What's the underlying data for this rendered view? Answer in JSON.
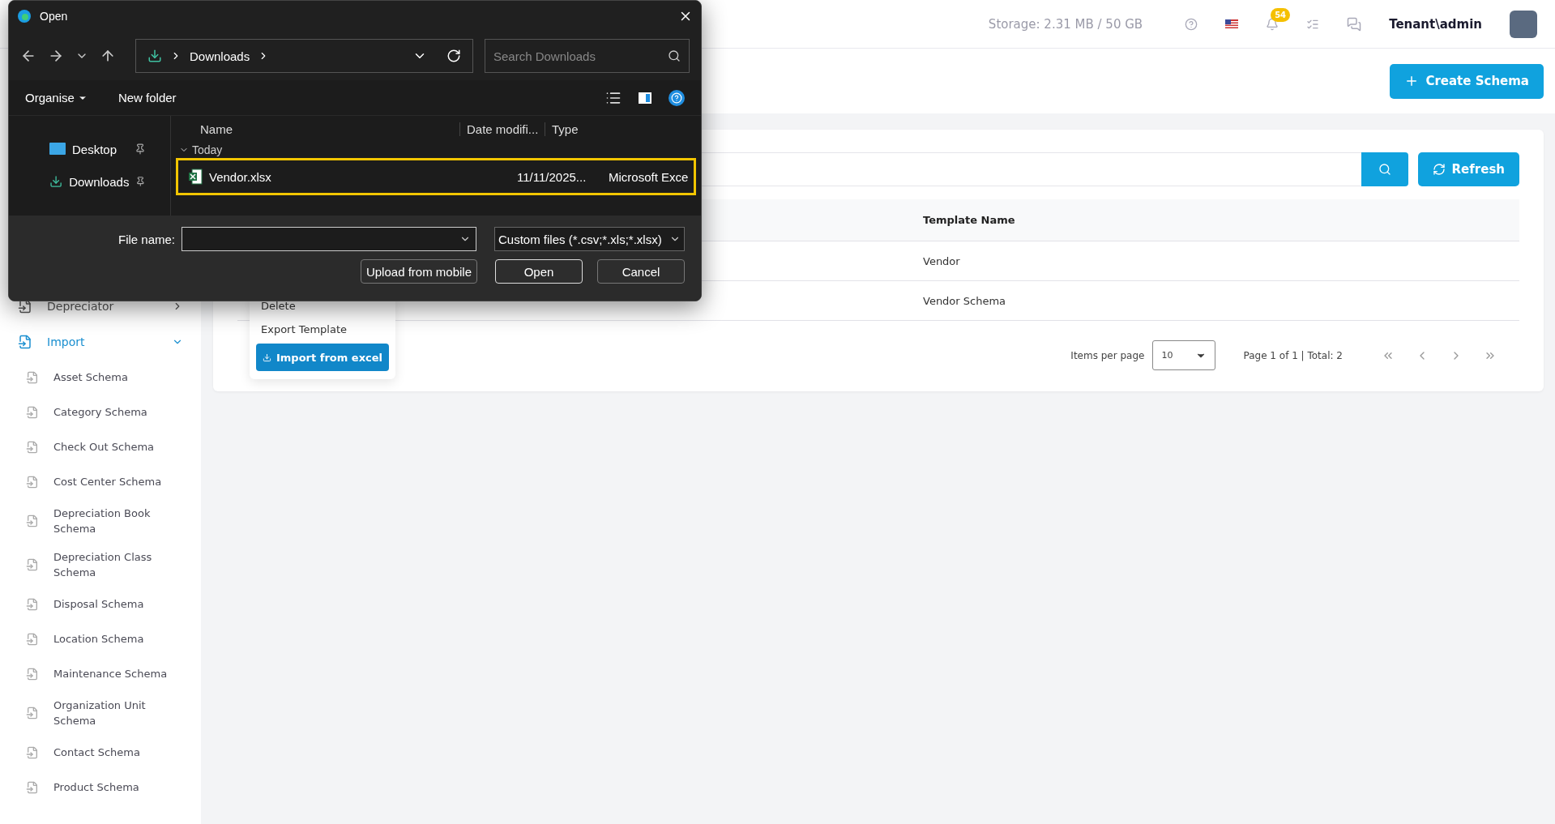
{
  "topbar": {
    "storage": "Storage: 2.31 MB / 50 GB",
    "notification_count": "54",
    "user": "Tenant\\admin"
  },
  "header": {
    "create_button": "Create Schema"
  },
  "toolbar": {
    "refresh_button": "Refresh"
  },
  "table": {
    "columns": [
      "Template Name"
    ],
    "rows": [
      {
        "template_name": "Vendor"
      },
      {
        "template_name": "Vendor Schema"
      }
    ]
  },
  "pagination": {
    "items_per_page_label": "Items per page",
    "items_per_page": "10",
    "page_info": "Page 1 of 1 | Total: 2"
  },
  "sidebar": {
    "items": [
      {
        "label": "Depreciator",
        "expanded": false,
        "active": false
      },
      {
        "label": "Import",
        "expanded": true,
        "active": true,
        "children": [
          {
            "label": "Asset Schema"
          },
          {
            "label": "Category Schema"
          },
          {
            "label": "Check Out Schema"
          },
          {
            "label": "Cost Center Schema"
          },
          {
            "label": "Depreciation Book Schema"
          },
          {
            "label": "Depreciation Class Schema"
          },
          {
            "label": "Disposal Schema"
          },
          {
            "label": "Location Schema"
          },
          {
            "label": "Maintenance Schema"
          },
          {
            "label": "Organization Unit Schema"
          },
          {
            "label": "Contact Schema"
          },
          {
            "label": "Product Schema"
          }
        ]
      }
    ]
  },
  "context_menu": {
    "items": [
      {
        "label": "Delete",
        "kind": "item"
      },
      {
        "label": "Export Template",
        "kind": "item"
      },
      {
        "label": "Import from excel",
        "kind": "button"
      }
    ]
  },
  "dialog": {
    "title": "Open",
    "breadcrumb": [
      "Downloads"
    ],
    "search_placeholder": "Search Downloads",
    "organise": "Organise",
    "new_folder": "New folder",
    "nav_items": [
      {
        "label": "Desktop",
        "kind": "desktop",
        "pinned": true
      },
      {
        "label": "Downloads",
        "kind": "downloads",
        "pinned": true
      }
    ],
    "columns": [
      "Name",
      "Date modifi...",
      "Type"
    ],
    "group": "Today",
    "files": [
      {
        "name": "Vendor.xlsx",
        "date": "11/11/2025...",
        "type": "Microsoft Exce",
        "selected": true
      }
    ],
    "file_name_label": "File name:",
    "filter": "Custom files (*.csv;*.xls;*.xlsx)",
    "buttons": [
      {
        "label": "Upload from mobile",
        "kind": "secondary"
      },
      {
        "label": "Open",
        "kind": "default"
      },
      {
        "label": "Cancel",
        "kind": "secondary"
      }
    ]
  }
}
